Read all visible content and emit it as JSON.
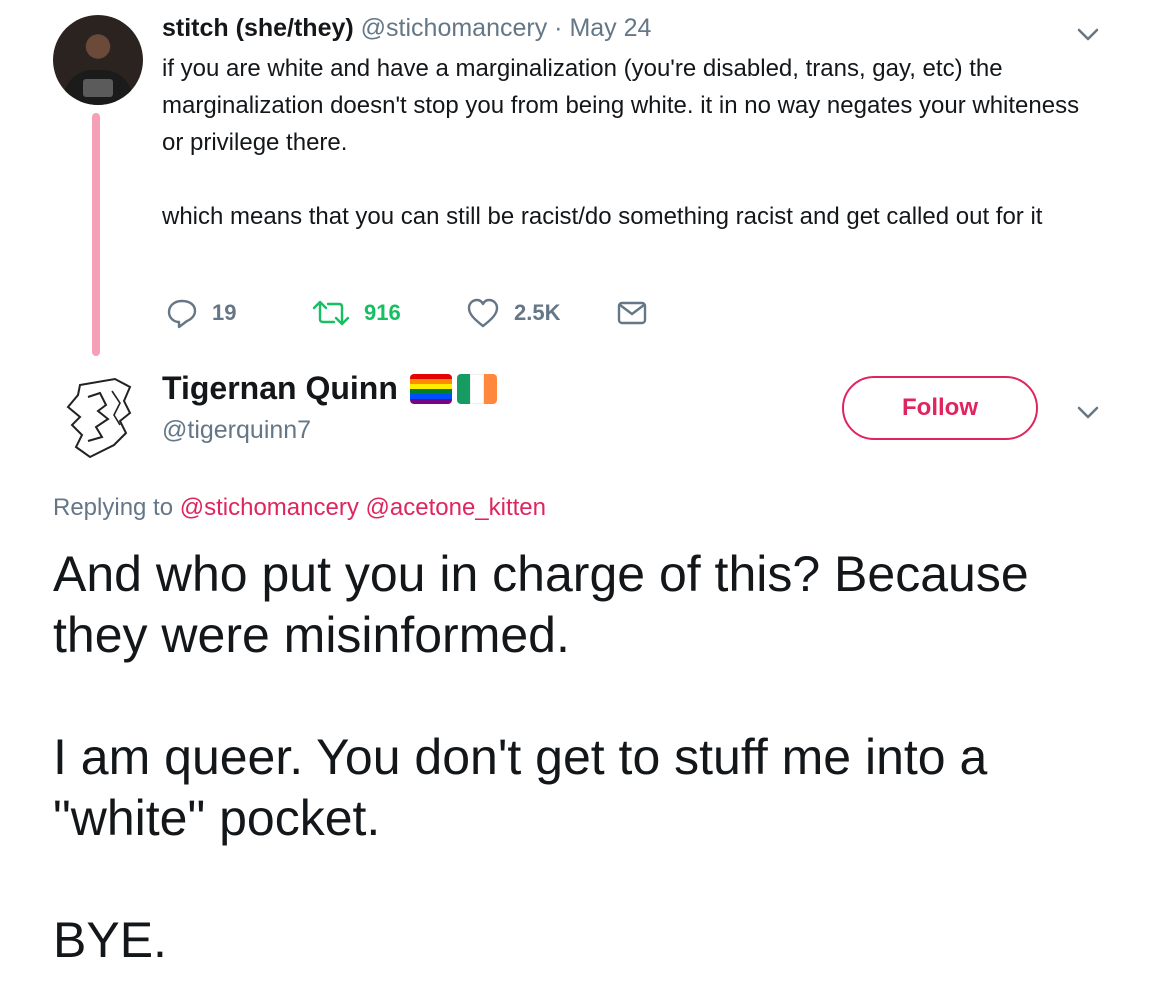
{
  "tweet1": {
    "display_name": "stitch (she/they)",
    "handle": "@stichomancery",
    "separator": "·",
    "date": "May 24",
    "paragraphs": [
      "if you are white and have a marginalization (you're disabled, trans, gay, etc) the marginalization doesn't stop you from being white. it in no way negates your whiteness or privilege there.",
      "which means that you can still be racist/do something racist and get called out for it"
    ],
    "actions": {
      "replies": "19",
      "retweets": "916",
      "likes": "2.5K"
    },
    "thread_color": "#f5a0b5"
  },
  "tweet2": {
    "display_name": "Tigernan Quinn",
    "handle": "@tigerquinn7",
    "flag_icons": [
      "rainbow-flag-icon",
      "ireland-flag-icon"
    ],
    "follow_label": "Follow",
    "replying_prefix": "Replying to",
    "replying_to": [
      "@stichomancery",
      "@acetone_kitten"
    ],
    "paragraphs": [
      "And who put you in charge of this?  Because they were misinformed.",
      "I am queer.  You don't get to stuff me into a \"white\" pocket.",
      "BYE."
    ]
  },
  "colors": {
    "accent": "#e0245e",
    "muted": "#657786",
    "retweet_green": "#17bf63",
    "text": "#14171a"
  }
}
